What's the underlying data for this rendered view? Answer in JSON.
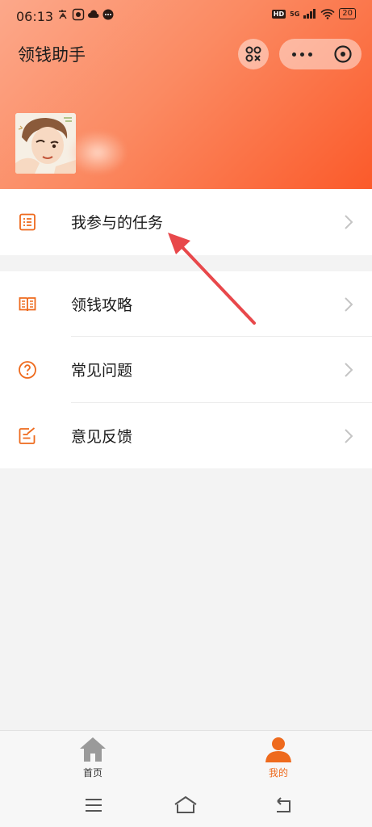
{
  "status_bar": {
    "time": "06:13",
    "network": "5G",
    "battery": "20"
  },
  "header": {
    "title": "领钱助手"
  },
  "menu": {
    "my_tasks": "我参与的任务",
    "guide": "领钱攻略",
    "faq": "常见问题",
    "feedback": "意见反馈"
  },
  "tabbar": {
    "home": "首页",
    "me": "我的"
  },
  "colors": {
    "accent": "#ee6a1d",
    "header_gradient_start": "#fca88a",
    "header_gradient_end": "#fb5a2a",
    "annotation_arrow": "#e8484b"
  }
}
